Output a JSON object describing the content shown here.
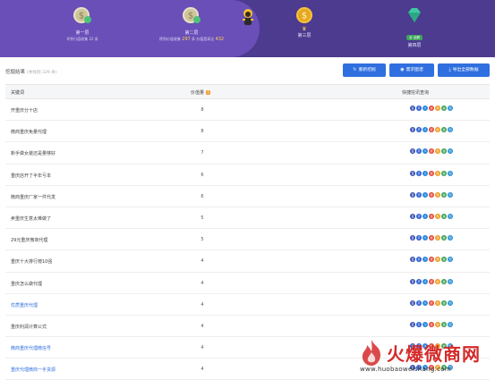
{
  "banner": {
    "stages": [
      {
        "name": "第一层",
        "sub_prefix": "寻到行值收集 22 条",
        "sub_value": "",
        "sub_suffix": ""
      },
      {
        "name": "第二层",
        "sub_prefix": "得到价值收集",
        "sub_value": "297",
        "sub_mid": "条 价值是高达",
        "sub_value2": "432"
      },
      {
        "name": "第三层",
        "crown": "♛"
      },
      {
        "name": "第四层",
        "badge": "全 全解"
      }
    ],
    "track_color": "#6a4fb8",
    "bg_color": "#4c3b8f"
  },
  "toolbar": {
    "title": "挖掘结果",
    "count": "(共找到 329 条)",
    "refresh_label": "重新挖掘",
    "demand_label": "需求图谱",
    "export_label": "导出全部数据"
  },
  "table": {
    "headers": {
      "keyword": "关键词",
      "value": "价值量",
      "value_hint": "?",
      "tools": "快捷挖讯查询"
    },
    "rows": [
      {
        "keyword": "开重庆分十店",
        "value": "8",
        "link": false
      },
      {
        "keyword": "微商重庆免量代理",
        "value": "8",
        "link": false
      },
      {
        "keyword": "新手做女装还是量够好",
        "value": "7",
        "link": false
      },
      {
        "keyword": "重庆店开了半年亏本",
        "value": "6",
        "link": false
      },
      {
        "keyword": "微商重庆厂家一件代发",
        "value": "6",
        "link": false
      },
      {
        "keyword": "卖重庆生意太难做了",
        "value": "5",
        "link": false
      },
      {
        "keyword": "29元重庆微商代理",
        "value": "5",
        "link": false
      },
      {
        "keyword": "重庆十大排行榜10强",
        "value": "4",
        "link": false
      },
      {
        "keyword": "重庆怎么做代理",
        "value": "4",
        "link": false
      },
      {
        "keyword": "优质重庆代理",
        "value": "4",
        "link": true
      },
      {
        "keyword": "重庆利润计算公式",
        "value": "4",
        "link": false
      },
      {
        "keyword": "微商重庆代理微信号",
        "value": "4",
        "link": true
      },
      {
        "keyword": "重庆代理微商一手货源",
        "value": "4",
        "link": true
      }
    ],
    "tool_icons": [
      "baidu-icon",
      "baidu-mobile-icon",
      "360-icon",
      "sogou-icon",
      "weibo-icon",
      "wechat-icon",
      "zhihu-icon"
    ]
  },
  "watermark": {
    "text": "火爆微商网",
    "url": "www.huobaoweishang.com"
  }
}
